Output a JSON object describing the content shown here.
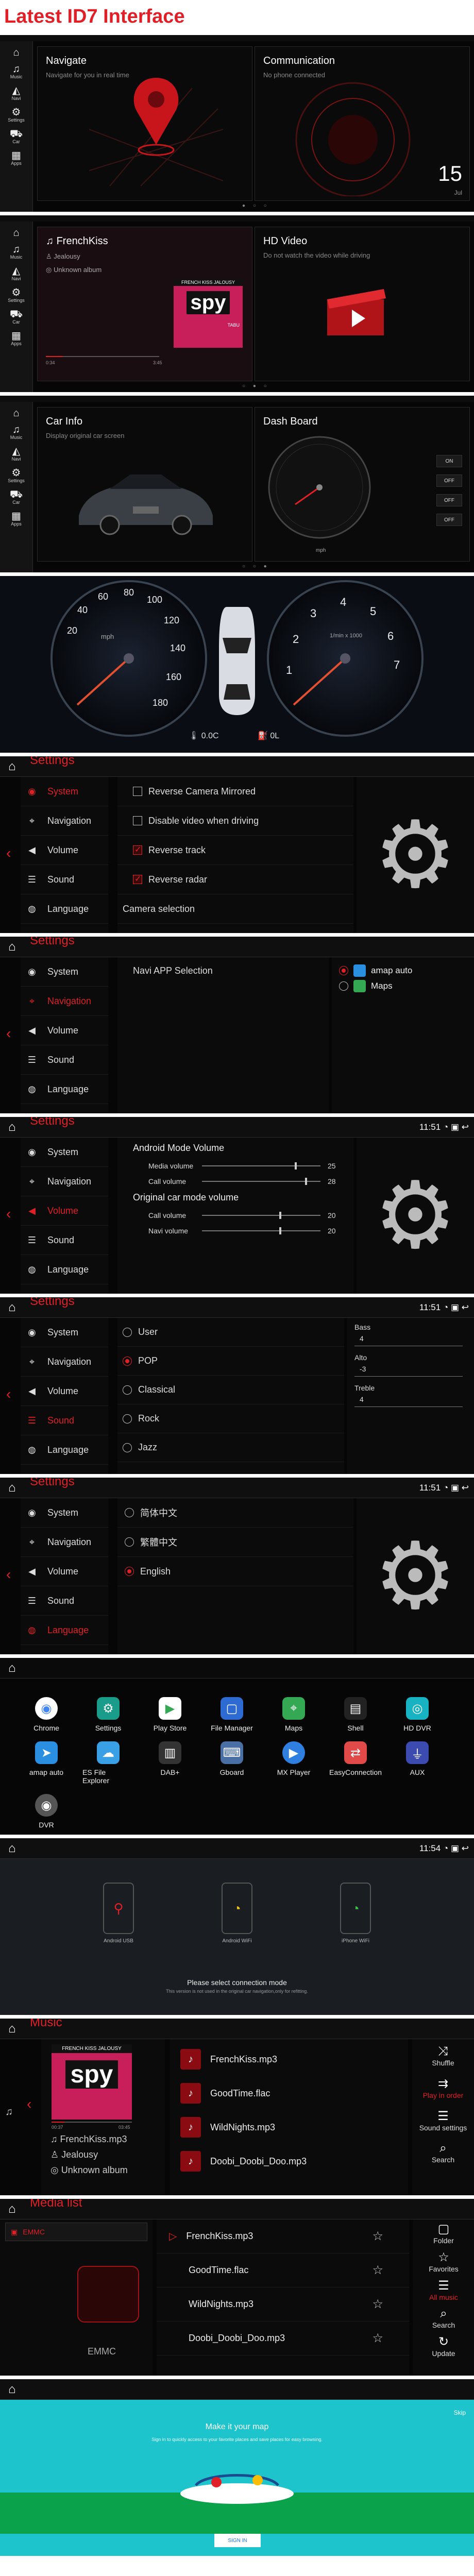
{
  "page_title": "Latest ID7 Interface",
  "sidebar": [
    "Music",
    "Navi",
    "Settings",
    "Car",
    "Apps"
  ],
  "s1": {
    "left_title": "Navigate",
    "left_sub": "Navigate for you in real time",
    "right_title": "Communication",
    "right_sub": "No phone connected",
    "day": "15",
    "weekday": "Jul"
  },
  "s2": {
    "track": "FrenchKiss",
    "artist": "Jealousy",
    "album": "Unknown album",
    "t_start": "0:34",
    "t_end": "3:45",
    "right_title": "HD Video",
    "right_sub": "Do not watch the video while driving",
    "cover_text": "FRENCH KISS JALOUSY",
    "cover_logo": "spy",
    "cover_brand": "TABU"
  },
  "s3": {
    "left_title": "Car Info",
    "left_sub": "Display original car screen",
    "right_title": "Dash Board",
    "rpm_label": "rpm",
    "toggles": [
      "ON",
      "OFF",
      "OFF",
      "OFF"
    ],
    "gauge_unit": "mph"
  },
  "s4": {
    "left_ticks": [
      "20",
      "40",
      "60",
      "80",
      "100",
      "120",
      "140",
      "160",
      "180"
    ],
    "left_unit": "mph",
    "right_ticks": [
      "1",
      "2",
      "3",
      "4",
      "5",
      "6",
      "7"
    ],
    "right_unit": "1/min x 1000",
    "temp": "0.0C",
    "fuel": "0L"
  },
  "settings_title": "Settings",
  "nav": {
    "s5": [
      "System",
      "Navigation",
      "Volume",
      "Sound",
      "Language"
    ],
    "s6": [
      "System",
      "Navigation",
      "Volume",
      "Sound",
      "Language"
    ],
    "s7": [
      "System",
      "Navigation",
      "Volume",
      "Sound",
      "Language"
    ],
    "s8": [
      "System",
      "Navigation",
      "Volume",
      "Sound",
      "Language"
    ],
    "s9": [
      "System",
      "Navigation",
      "Volume",
      "Sound",
      "Language"
    ]
  },
  "s5": {
    "opts": [
      "Reverse Camera Mirrored",
      "Disable video when driving",
      "Reverse track",
      "Reverse radar",
      "Camera selection"
    ],
    "checked": [
      false,
      false,
      true,
      true
    ]
  },
  "s6": {
    "heading": "Navi APP Selection",
    "apps": [
      "amap auto",
      "Maps"
    ]
  },
  "time": "11:51",
  "s7": {
    "h1": "Android Mode Volume",
    "r1": [
      {
        "label": "Media volume",
        "val": "25"
      },
      {
        "label": "Call volume",
        "val": "28"
      }
    ],
    "h2": "Original car mode volume",
    "r2": [
      {
        "label": "Call volume",
        "val": "20"
      },
      {
        "label": "Navi volume",
        "val": "20"
      }
    ]
  },
  "s8": {
    "modes": [
      "User",
      "POP",
      "Classical",
      "Rock",
      "Jazz"
    ],
    "eq": [
      {
        "label": "Bass",
        "val": "4"
      },
      {
        "label": "Alto",
        "val": "-3"
      },
      {
        "label": "Treble",
        "val": "4"
      }
    ]
  },
  "s9": {
    "langs": [
      "简体中文",
      "繁體中文",
      "English"
    ]
  },
  "s10": {
    "apps": [
      "Chrome",
      "Settings",
      "Play Store",
      "File Manager",
      "Maps",
      "Shell",
      "HD DVR",
      "amap auto",
      "ES File Explorer",
      "DAB+",
      "Gboard",
      "MX Player",
      "EasyConnection",
      "AUX",
      "DVR"
    ]
  },
  "s11": {
    "time": "11:54",
    "phones": [
      "Android USB",
      "Android WiFi",
      "iPhone WiFi"
    ],
    "msg": "Please select connection mode",
    "sub": "This version is not used in the original car navigation,only for refitting."
  },
  "s12": {
    "title": "Music",
    "tracks": [
      "FrenchKiss.mp3",
      "GoodTime.flac",
      "WildNights.mp3",
      "Doobi_Doobi_Doo.mp3"
    ],
    "cover_text": "FRENCH KISS JALOUSY",
    "cover_logo": "spy",
    "t_start": "00:37",
    "t_end": "03:45",
    "song": "FrenchKiss.mp3",
    "artist": "Jealousy",
    "album": "Unknown album",
    "side": [
      "Shuffle",
      "Play in order",
      "Sound settings",
      "Search"
    ]
  },
  "s13": {
    "title": "Media list",
    "source": "EMMC",
    "source2": "EMMC",
    "tracks": [
      "FrenchKiss.mp3",
      "GoodTime.flac",
      "WildNights.mp3",
      "Doobi_Doobi_Doo.mp3"
    ],
    "side": [
      "Folder",
      "Favorites",
      "All music",
      "Search",
      "Update"
    ]
  },
  "s14": {
    "skip": "Skip",
    "heading": "Make it your map",
    "sub": "Sign in to quickly access to your favorite places and save places for easy browsing.",
    "btn": "SIGN IN"
  }
}
